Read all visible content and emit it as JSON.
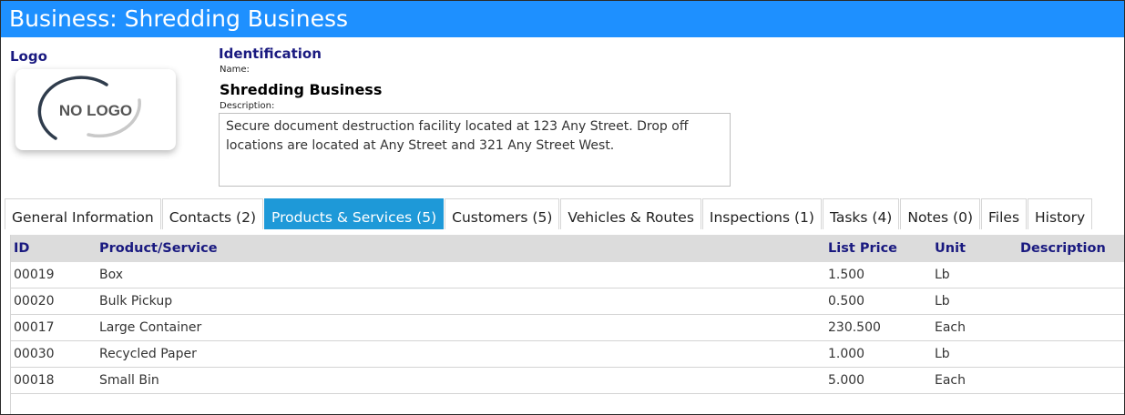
{
  "window": {
    "title": "Business: Shredding Business"
  },
  "logo": {
    "section_label": "Logo",
    "placeholder_text": "NO LOGO"
  },
  "identification": {
    "section_label": "Identification",
    "name_label": "Name:",
    "name_value": "Shredding Business",
    "description_label": "Description:",
    "description_value": "Secure document destruction facility located at 123 Any Street. Drop off locations are located at Any Street and 321 Any Street West."
  },
  "tabs": [
    {
      "label": "General Information",
      "active": false
    },
    {
      "label": "Contacts (2)",
      "active": false
    },
    {
      "label": "Products & Services (5)",
      "active": true
    },
    {
      "label": "Customers (5)",
      "active": false
    },
    {
      "label": "Vehicles & Routes",
      "active": false
    },
    {
      "label": "Inspections (1)",
      "active": false
    },
    {
      "label": "Tasks (4)",
      "active": false
    },
    {
      "label": "Notes (0)",
      "active": false
    },
    {
      "label": "Files",
      "active": false
    },
    {
      "label": "History",
      "active": false
    }
  ],
  "table": {
    "columns": {
      "id": "ID",
      "product": "Product/Service",
      "list_price": "List Price",
      "unit": "Unit",
      "description": "Description"
    },
    "rows": [
      {
        "id": "00019",
        "product": "Box",
        "list_price": "1.500",
        "unit": "Lb",
        "description": ""
      },
      {
        "id": "00020",
        "product": "Bulk Pickup",
        "list_price": "0.500",
        "unit": "Lb",
        "description": ""
      },
      {
        "id": "00017",
        "product": "Large Container",
        "list_price": "230.500",
        "unit": "Each",
        "description": ""
      },
      {
        "id": "00030",
        "product": "Recycled Paper",
        "list_price": "1.000",
        "unit": "Lb",
        "description": ""
      },
      {
        "id": "00018",
        "product": "Small Bin",
        "list_price": "5.000",
        "unit": "Each",
        "description": ""
      }
    ]
  },
  "colors": {
    "title_bar": "#1e90ff",
    "active_tab": "#1e99d8",
    "section_label": "#1a1a80",
    "table_header_bg": "#dcdcdc"
  }
}
